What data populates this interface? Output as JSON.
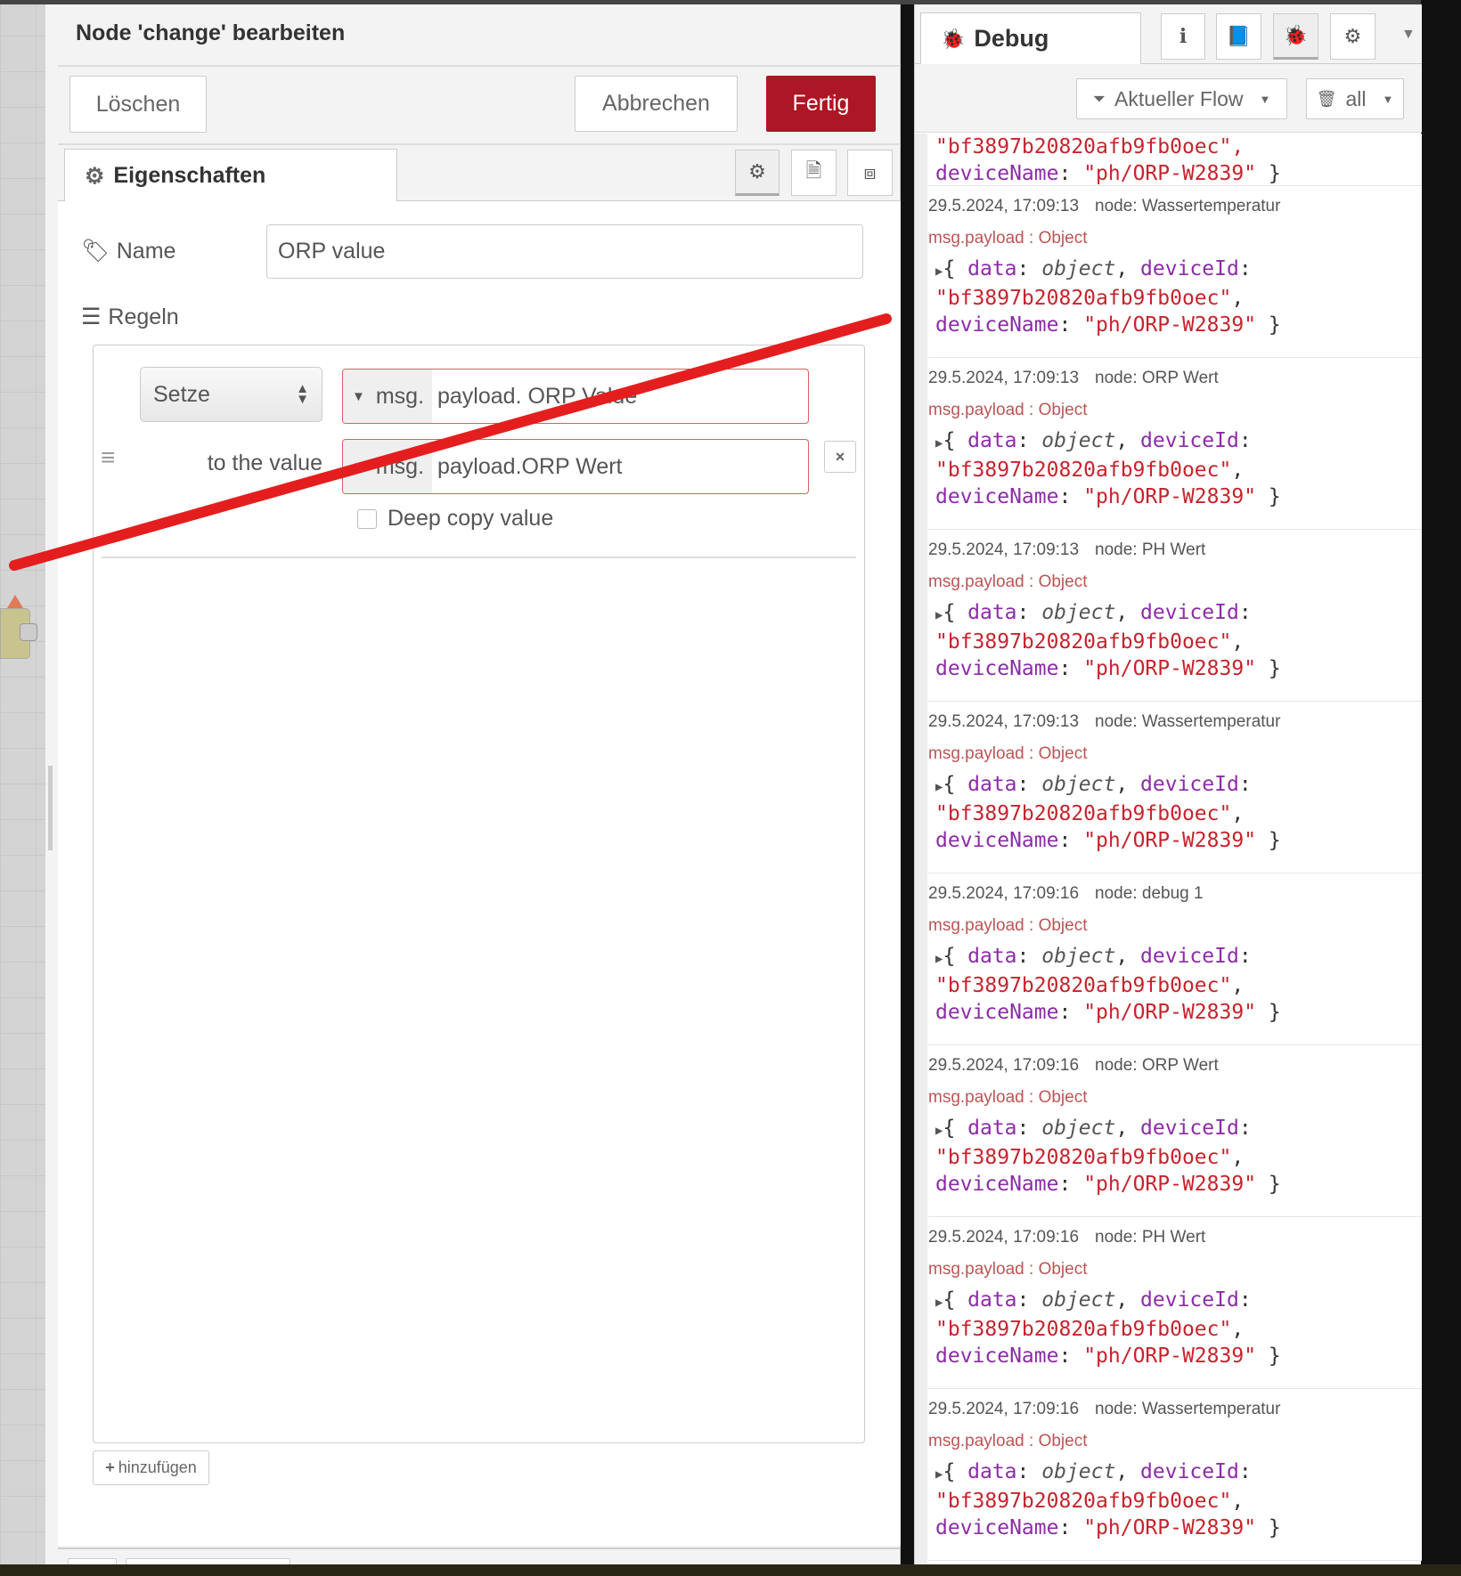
{
  "dialog": {
    "title": "Node 'change' bearbeiten",
    "delete_label": "Löschen",
    "cancel_label": "Abbrechen",
    "done_label": "Fertig",
    "tab_label": "Eigenschaften",
    "name_label": "Name",
    "name_value": "ORP value",
    "rules_label": "Regeln",
    "rule": {
      "action": "Setze",
      "target_prefix": "msg.",
      "target_value": "payload. ORP Value",
      "to_label": "to the value",
      "source_prefix": "msg.",
      "source_value": "payload.ORP Wert",
      "deep_copy_label": "Deep copy value",
      "deep_copy_checked": false
    },
    "add_label": "hinzufügen"
  },
  "debug": {
    "tab_label": "Debug",
    "filter_label": "Aktueller Flow",
    "clear_label": "all",
    "partial": {
      "id_fragment": "\"bf3897b20820afb9fb0oec\",",
      "name_line_key": "deviceName",
      "name_line_val": "\"ph/ORP-W2839\""
    },
    "entries": [
      {
        "time": "29.5.2024, 17:09:13",
        "node": "node: Wassertemperatur"
      },
      {
        "time": "29.5.2024, 17:09:13",
        "node": "node: ORP Wert"
      },
      {
        "time": "29.5.2024, 17:09:13",
        "node": "node: PH Wert"
      },
      {
        "time": "29.5.2024, 17:09:13",
        "node": "node: Wassertemperatur"
      },
      {
        "time": "29.5.2024, 17:09:16",
        "node": "node: debug 1"
      },
      {
        "time": "29.5.2024, 17:09:16",
        "node": "node: ORP Wert"
      },
      {
        "time": "29.5.2024, 17:09:16",
        "node": "node: PH Wert"
      },
      {
        "time": "29.5.2024, 17:09:16",
        "node": "node: Wassertemperatur"
      }
    ],
    "topic": "msg.payload : Object",
    "obj": {
      "k_data": "data",
      "v_data": "object",
      "k_id": "deviceId",
      "v_id": "\"bf3897b20820afb9fb0oec\"",
      "k_name": "deviceName",
      "v_name": "\"ph/ORP-W2839\""
    }
  },
  "colors": {
    "accent": "#ad1625",
    "annotation": "#e41e1e"
  }
}
